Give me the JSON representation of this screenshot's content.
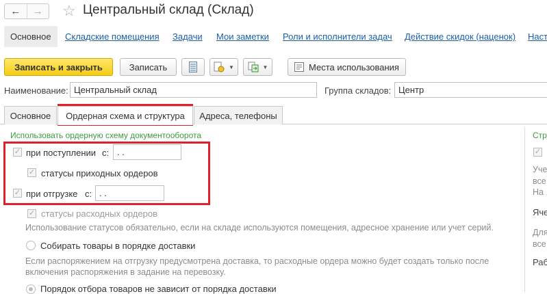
{
  "window": {
    "title": "Центральный склад (Склад)",
    "back_icon": "arrow-left-icon",
    "forward_icon": "arrow-right-icon",
    "favorite_icon": "star-icon"
  },
  "sections": {
    "active": "Основное",
    "links": [
      "Складские помещения",
      "Задачи",
      "Мои заметки",
      "Роли и исполнители задач",
      "Действие скидок (наценок)",
      "Наст"
    ]
  },
  "toolbar": {
    "save_close": "Записать и закрыть",
    "save": "Записать",
    "usage_places": "Места использования"
  },
  "form": {
    "name_label": "Наименование:",
    "name_value": "Центральный склад",
    "group_label": "Группа складов:",
    "group_value": "Центр"
  },
  "tabs": [
    "Основное",
    "Ордерная схема и структура",
    "Адреса, телефоны"
  ],
  "order_scheme": {
    "heading": "Использовать ордерную схему документооборота",
    "receipt_label": "при поступлении",
    "receipt_from_label": "с:",
    "receipt_date": " .  .",
    "receipt_statuses": "статусы приходных ордеров",
    "shipment_label": "при отгрузке",
    "shipment_from_label": "с:",
    "shipment_date": " .  .",
    "shipment_statuses": "статусы расходных ордеров",
    "statuses_note": "Использование статусов обязательно, если на складе используются помещения, адресное хранение или учет серий.",
    "collect_by_delivery": "Собирать товары в порядке доставки",
    "delivery_note_1": "Если распоряжением на отгрузку предусмотрена доставка, то расходные ордера можно будет создать только после",
    "delivery_note_2": "включения распоряжения в задание на перевозку.",
    "pick_independent": "Порядок отбора товаров не зависит от порядка доставки"
  },
  "right_column": {
    "heading": "Стр",
    "line1": "Уче",
    "line2": "все",
    "line3": "На ,",
    "line4": "Яче",
    "line5": "Для",
    "line6": "все",
    "line7": "Раб"
  },
  "colors": {
    "accent_yellow": "#f5cc15",
    "link_blue": "#1c5ea8",
    "highlight_red": "#e0202a",
    "heading_green": "#3e9a3e"
  }
}
